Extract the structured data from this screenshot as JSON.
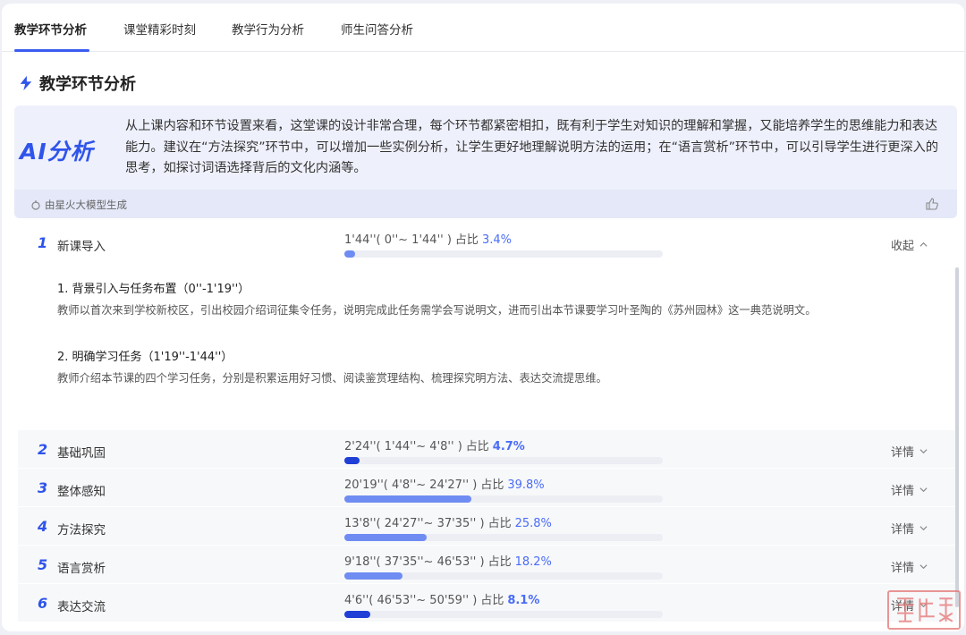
{
  "tabs": [
    "教学环节分析",
    "课堂精彩时刻",
    "教学行为分析",
    "师生问答分析"
  ],
  "section_title": "教学环节分析",
  "ai": {
    "logo": "AI分析",
    "text": "从上课内容和环节设置来看，这堂课的设计非常合理，每个环节都紧密相扣，既有利于学生对知识的理解和掌握，又能培养学生的思维能力和表达能力。建议在“方法探究”环节中，可以增加一些实例分析，让学生更好地理解说明方法的运用；在“语言赏析”环节中，可以引导学生进行更深入的思考，如探讨词语选择背后的文化内涵等。",
    "source": "由星火大模型生成"
  },
  "segments": [
    {
      "num": "1",
      "name": "新课导入",
      "time": "1'44''( 0''~ 1'44'' )",
      "pct_label": "占比",
      "pct": "3.4%",
      "fraction": 0.034,
      "action": "收起",
      "expanded": true,
      "details": [
        {
          "title": "1. 背景引入与任务布置（0''-1'19''）",
          "text": "教师以首次来到学校新校区，引出校园介绍词征集令任务，说明完成此任务需学会写说明文，进而引出本节课要学习叶圣陶的《苏州园林》这一典范说明文。"
        },
        {
          "title": "2. 明确学习任务（1'19''-1'44''）",
          "text": "教师介绍本节课的四个学习任务，分别是积累运用好习惯、阅读鉴赏理结构、梳理探究明方法、表达交流提思维。"
        }
      ]
    },
    {
      "num": "2",
      "name": "基础巩固",
      "time": "2'24''( 1'44''~ 4'8'' )",
      "pct_label": "占比",
      "pct": "4.7%",
      "fraction": 0.047,
      "action": "详情",
      "bold": true
    },
    {
      "num": "3",
      "name": "整体感知",
      "time": "20'19''( 4'8''~ 24'27'' )",
      "pct_label": "占比",
      "pct": "39.8%",
      "fraction": 0.398,
      "action": "详情"
    },
    {
      "num": "4",
      "name": "方法探究",
      "time": "13'8''( 24'27''~ 37'35'' )",
      "pct_label": "占比",
      "pct": "25.8%",
      "fraction": 0.258,
      "action": "详情"
    },
    {
      "num": "5",
      "name": "语言赏析",
      "time": "9'18''( 37'35''~ 46'53'' )",
      "pct_label": "占比",
      "pct": "18.2%",
      "fraction": 0.182,
      "action": "详情"
    },
    {
      "num": "6",
      "name": "表达交流",
      "time": "4'6''( 46'53''~ 50'59'' )",
      "pct_label": "占比",
      "pct": "8.1%",
      "fraction": 0.081,
      "action": "详情",
      "bold": true
    }
  ],
  "colors": {
    "accent": "#2f54eb",
    "bar_light": "#6f8cf2",
    "bar_dark": "#1f3fd6"
  }
}
